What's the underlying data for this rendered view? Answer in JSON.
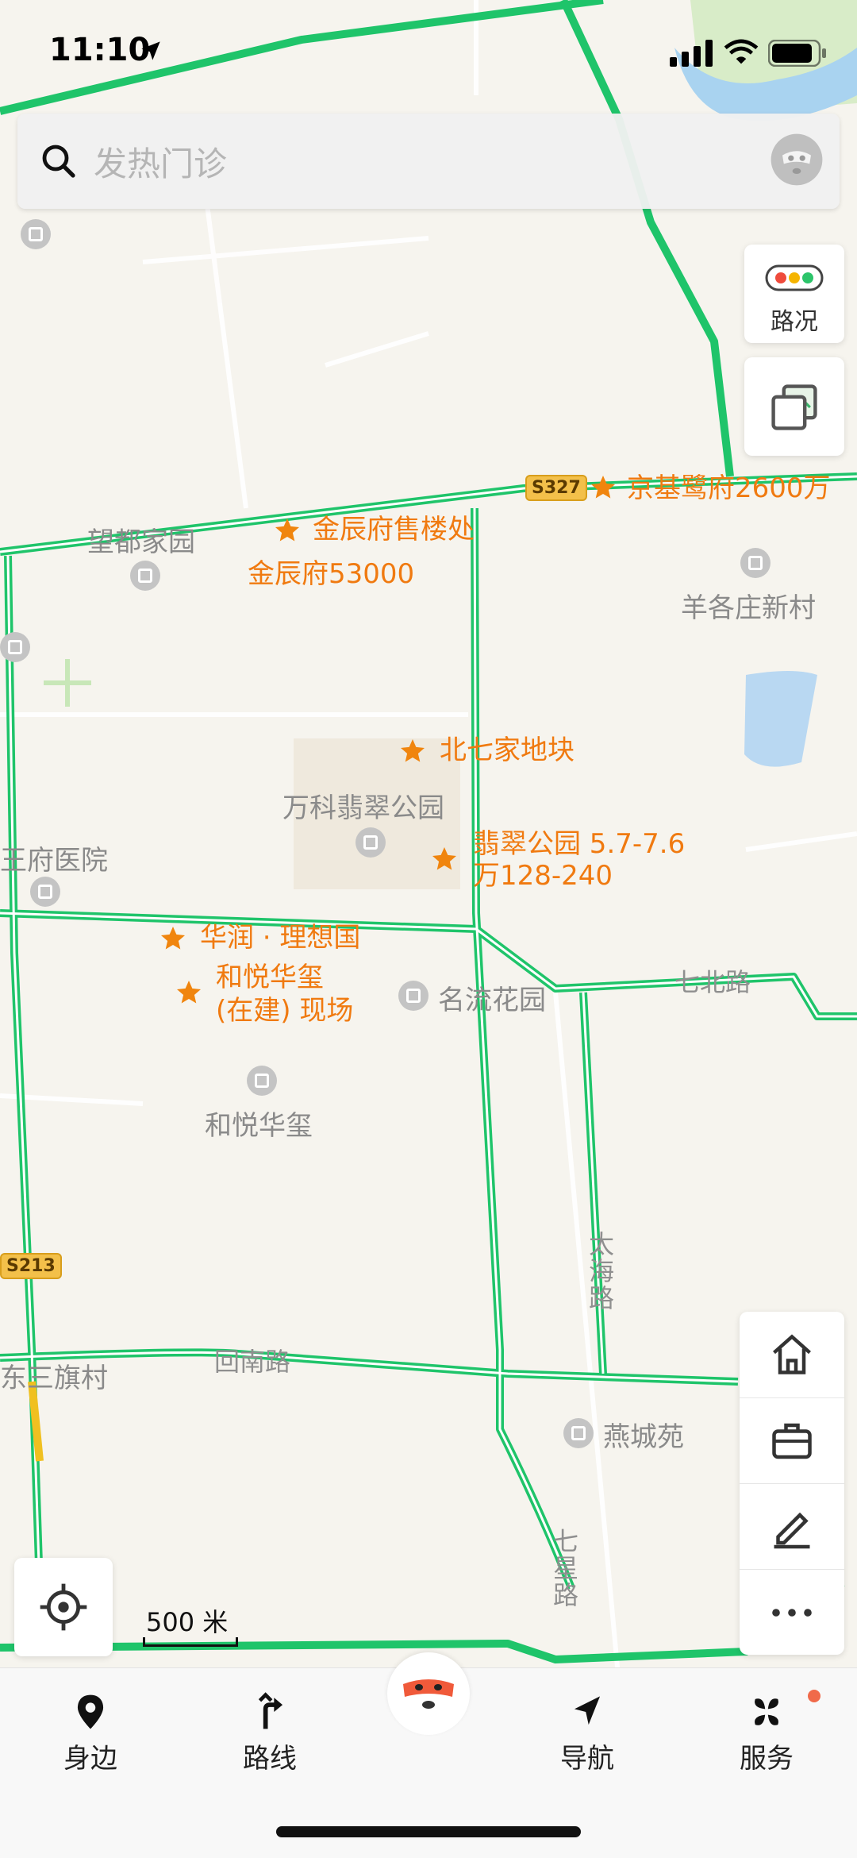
{
  "status_bar": {
    "time": "11:10"
  },
  "search": {
    "placeholder": "发热门诊"
  },
  "controls": {
    "traffic_label": "路况",
    "scale_label": "500 米"
  },
  "map": {
    "roads": [
      "回南路",
      "七北路",
      "太海路",
      "七星路"
    ],
    "highways": [
      "S327",
      "S213"
    ],
    "pois": [
      "望都家园",
      "羊各庄新村",
      "万科翡翠公园",
      "名流花园",
      "和悦华玺",
      "燕城苑",
      "东三旗村",
      "王府医院"
    ],
    "favorites": [
      "京基鹭府2600万",
      "金辰府售楼处",
      "金辰府53000",
      "北七家地块",
      "翡翠公园 5.7-7.6",
      "万128-240",
      "华润 · 理想国",
      "和悦华玺",
      "(在建) 现场"
    ]
  },
  "bottom_nav": [
    {
      "label": "身边",
      "icon": "location-pin-icon"
    },
    {
      "label": "路线",
      "icon": "route-arrow-icon"
    },
    {
      "label": "",
      "icon": "mascot-icon"
    },
    {
      "label": "导航",
      "icon": "navigation-arrow-icon"
    },
    {
      "label": "服务",
      "icon": "services-grid-icon"
    }
  ]
}
